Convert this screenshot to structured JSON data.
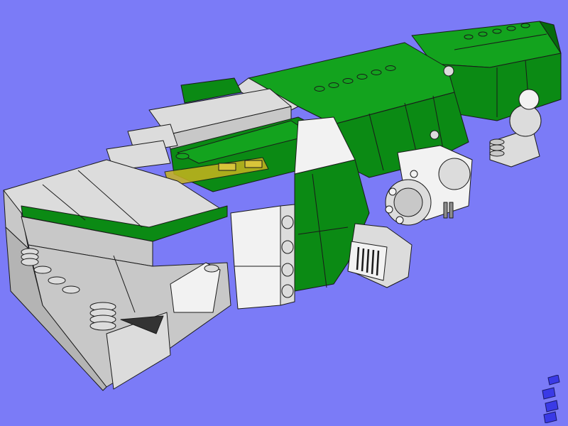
{
  "scene": {
    "subject": "brick-model-render",
    "background_color": "#7b7bf7",
    "colors": {
      "green": "#0b8a14",
      "green_top": "#13a31e",
      "green_dark": "#066a0d",
      "light_gray": "#c8c8c8",
      "light_gray_top": "#dcdcdc",
      "white": "#f2f2f2",
      "dark_gray": "#8c8c8c",
      "trans_yellow": "#c8b41e",
      "edge": "#1a1a1a",
      "logo_blue": "#3a3ae6"
    }
  },
  "logo": {
    "icon": "stacked-bricks-icon"
  }
}
